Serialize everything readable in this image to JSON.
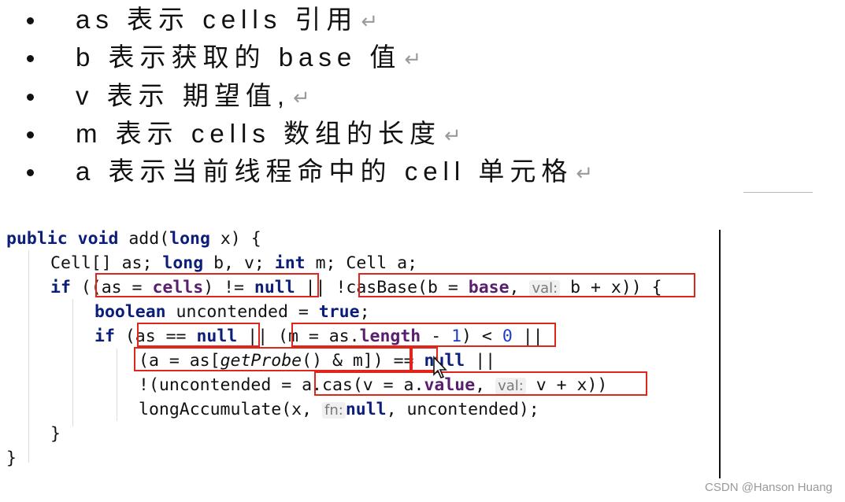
{
  "bullets": [
    {
      "text": "as  表示 cells 引用",
      "return_mark": "↵"
    },
    {
      "text": "b 表示获取的 base 值",
      "return_mark": "↵"
    },
    {
      "text": "v 表示  期望值,",
      "return_mark": "↵"
    },
    {
      "text": "m 表示  cells  数组的长度",
      "return_mark": "↵"
    },
    {
      "text": "a 表示当前线程命中的 cell 单元格",
      "return_mark": "↵"
    }
  ],
  "code": {
    "l1": {
      "kw1": "public",
      "kw2": "void",
      "name": "add(",
      "kw3": "long",
      "rest": " x) {"
    },
    "l2": {
      "t1": "Cell[] as; ",
      "kw1": "long",
      "t2": " b, v; ",
      "kw2": "int",
      "t3": " m; Cell a;"
    },
    "l3": {
      "kw1": "if",
      "t1": " ((as = ",
      "fld1": "cells",
      "t2": ") != ",
      "kw2": "null",
      "t3": " || !casBase(b = ",
      "fld2": "base",
      "t4": ", ",
      "hint": "val:",
      "t5": " b + x)) {"
    },
    "l4": {
      "kw1": "boolean",
      "t1": " uncontended = ",
      "kw2": "true",
      "t2": ";"
    },
    "l5": {
      "kw1": "if",
      "t1": " (as == ",
      "kw2": "null",
      "t2": " || (m = as.",
      "fld1": "length",
      "t3": " - ",
      "num1": "1",
      "t4": ") < ",
      "num2": "0",
      "t5": " ||"
    },
    "l6": {
      "t1": "(a = as[",
      "it1": "getProbe",
      "t2": "() & m]) == ",
      "kw1": "null",
      "t3": " ||"
    },
    "l7": {
      "t1": "!(uncontended = a.cas(v = a.",
      "fld1": "value",
      "t2": ", ",
      "hint": "val:",
      "t3": " v + x))"
    },
    "l8": {
      "t1": "longAccumulate(x, ",
      "hint": "fn:",
      "kw1": "null",
      "t2": ", uncontended);"
    },
    "l9": {
      "t1": "}"
    },
    "l10": {
      "t1": "}"
    }
  },
  "watermark": "CSDN @Hanson Huang",
  "colors": {
    "highlight_box": "#e0261b",
    "keyword": "#0a1e7a",
    "field": "#5a1e6e",
    "number": "#1a3fc4"
  }
}
